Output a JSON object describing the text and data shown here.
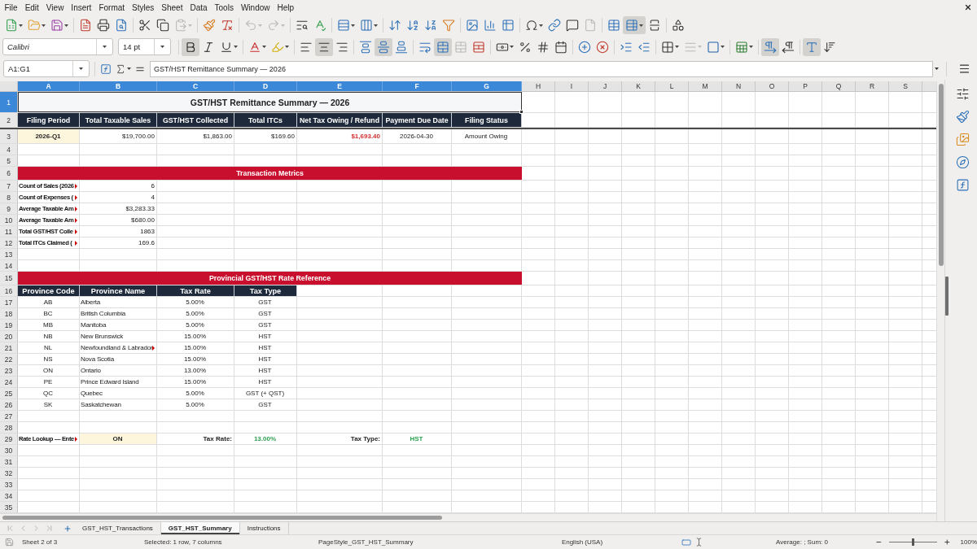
{
  "menu_bar": [
    "File",
    "Edit",
    "View",
    "Insert",
    "Format",
    "Styles",
    "Sheet",
    "Data",
    "Tools",
    "Window",
    "Help"
  ],
  "standard_toolbar": [
    [
      {
        "kind": "split",
        "active": false,
        "disabled": false
      },
      {
        "kind": "split",
        "active": false,
        "disabled": false
      },
      {
        "kind": "split",
        "active": false,
        "disabled": false
      }
    ],
    [
      {
        "kind": "button",
        "active": false,
        "disabled": false
      },
      {
        "kind": "button",
        "active": false,
        "disabled": false
      },
      {
        "kind": "button",
        "active": false,
        "disabled": false
      }
    ],
    [
      {
        "kind": "button",
        "active": false,
        "disabled": false
      },
      {
        "kind": "button",
        "active": false,
        "disabled": false
      },
      {
        "kind": "split",
        "active": false,
        "disabled": true
      }
    ],
    [
      {
        "kind": "button",
        "active": false,
        "disabled": false
      },
      {
        "kind": "button",
        "active": false,
        "disabled": false
      }
    ],
    [
      {
        "kind": "split",
        "active": false,
        "disabled": true
      },
      {
        "kind": "split",
        "active": false,
        "disabled": true
      }
    ],
    [
      {
        "kind": "button",
        "active": false,
        "disabled": false
      },
      {
        "kind": "button",
        "active": false,
        "disabled": false
      }
    ],
    [
      {
        "kind": "split",
        "active": false,
        "disabled": false
      },
      {
        "kind": "split",
        "active": false,
        "disabled": false
      }
    ],
    [
      {
        "kind": "button",
        "active": false,
        "disabled": false
      },
      {
        "kind": "button",
        "active": false,
        "disabled": false
      },
      {
        "kind": "button",
        "active": false,
        "disabled": false
      },
      {
        "kind": "button",
        "active": false,
        "disabled": false
      }
    ],
    [
      {
        "kind": "button",
        "active": false,
        "disabled": false
      },
      {
        "kind": "button",
        "active": false,
        "disabled": false
      },
      {
        "kind": "button",
        "active": false,
        "disabled": false
      }
    ],
    [
      {
        "kind": "split",
        "active": false,
        "disabled": false
      },
      {
        "kind": "button",
        "active": false,
        "disabled": false
      },
      {
        "kind": "button",
        "active": false,
        "disabled": false
      },
      {
        "kind": "button",
        "active": false,
        "disabled": true
      }
    ],
    [
      {
        "kind": "button",
        "active": false,
        "disabled": false
      },
      {
        "kind": "split",
        "active": true,
        "disabled": false
      },
      {
        "kind": "button",
        "active": false,
        "disabled": false
      }
    ],
    [
      {
        "kind": "button",
        "active": false,
        "disabled": false
      }
    ]
  ],
  "formatting_toolbar": {
    "font_name": "Calibri",
    "font_size": "14 pt",
    "groups": [
      [
        {
          "kind": "button",
          "active": true,
          "disabled": false
        },
        {
          "kind": "button",
          "active": false,
          "disabled": false
        },
        {
          "kind": "split",
          "active": false,
          "disabled": false
        }
      ],
      [
        {
          "kind": "split",
          "active": false,
          "disabled": false
        },
        {
          "kind": "split",
          "active": false,
          "disabled": false
        }
      ],
      [
        {
          "kind": "button",
          "active": false,
          "disabled": false
        },
        {
          "kind": "button",
          "active": true,
          "disabled": false
        },
        {
          "kind": "button",
          "active": false,
          "disabled": false
        }
      ],
      [
        {
          "kind": "button",
          "active": false,
          "disabled": false
        },
        {
          "kind": "button",
          "active": true,
          "disabled": false
        },
        {
          "kind": "button",
          "active": false,
          "disabled": false
        }
      ],
      [
        {
          "kind": "button",
          "active": false,
          "disabled": false
        },
        {
          "kind": "button",
          "active": true,
          "disabled": false
        },
        {
          "kind": "button",
          "active": false,
          "disabled": true
        },
        {
          "kind": "button",
          "active": false,
          "disabled": false
        }
      ],
      [
        {
          "kind": "split",
          "active": false,
          "disabled": false
        },
        {
          "kind": "button",
          "active": false,
          "disabled": false
        },
        {
          "kind": "button",
          "active": false,
          "disabled": false
        },
        {
          "kind": "button",
          "active": false,
          "disabled": false
        }
      ],
      [
        {
          "kind": "button",
          "active": false,
          "disabled": false
        },
        {
          "kind": "button",
          "active": false,
          "disabled": false
        }
      ],
      [
        {
          "kind": "button",
          "active": false,
          "disabled": false
        },
        {
          "kind": "button",
          "active": false,
          "disabled": false
        }
      ],
      [
        {
          "kind": "split",
          "active": false,
          "disabled": false
        },
        {
          "kind": "split",
          "active": false,
          "disabled": true
        },
        {
          "kind": "split",
          "active": false,
          "disabled": false
        }
      ],
      [
        {
          "kind": "split",
          "active": false,
          "disabled": false
        }
      ],
      [
        {
          "kind": "button",
          "active": true,
          "disabled": false
        },
        {
          "kind": "button",
          "active": false,
          "disabled": false
        }
      ],
      [
        {
          "kind": "button",
          "active": true,
          "disabled": false
        },
        {
          "kind": "button",
          "active": false,
          "disabled": false
        }
      ]
    ]
  },
  "formula_bar": {
    "name_box": "A1:G1",
    "content": "GST/HST Remittance Summary — 2026"
  },
  "sheet": {
    "columns": [
      {
        "label": "A",
        "selected": true
      },
      {
        "label": "B",
        "selected": true
      },
      {
        "label": "C",
        "selected": true
      },
      {
        "label": "D",
        "selected": true
      },
      {
        "label": "E",
        "selected": true
      },
      {
        "label": "F",
        "selected": true
      },
      {
        "label": "G",
        "selected": true
      },
      {
        "label": "H",
        "selected": false
      },
      {
        "label": "I",
        "selected": false
      },
      {
        "label": "J",
        "selected": false
      },
      {
        "label": "K",
        "selected": false
      },
      {
        "label": "L",
        "selected": false
      },
      {
        "label": "M",
        "selected": false
      },
      {
        "label": "N",
        "selected": false
      },
      {
        "label": "O",
        "selected": false
      },
      {
        "label": "P",
        "selected": false
      },
      {
        "label": "Q",
        "selected": false
      },
      {
        "label": "R",
        "selected": false
      },
      {
        "label": "S",
        "selected": false
      }
    ],
    "frozen_rows": [
      {
        "number": "1",
        "selected": true,
        "kind": "title",
        "cells": [
          {
            "text": "GST/HST Remittance Summary — 2026"
          }
        ]
      },
      {
        "number": "2",
        "selected": false,
        "kind": "header",
        "cells": [
          {
            "text": "Filing Period"
          },
          {
            "text": "Total Taxable Sales"
          },
          {
            "text": "GST/HST Collected"
          },
          {
            "text": "Total ITCs"
          },
          {
            "text": "Net Tax Owing / Refund"
          },
          {
            "text": "Payment Due Date"
          },
          {
            "text": "Filing Status"
          }
        ]
      }
    ],
    "rows": [
      {
        "number": "3",
        "selected": false,
        "kind": "data",
        "cells": [
          {
            "text": "2026-Q1",
            "kind": "input",
            "clipped": false
          },
          {
            "text": "$19,700.00",
            "kind": "number",
            "clipped": false
          },
          {
            "text": "$1,863.00",
            "kind": "number",
            "clipped": false
          },
          {
            "text": "$169.60",
            "kind": "number",
            "clipped": false
          },
          {
            "text": "$1,693.40",
            "kind": "alert",
            "clipped": false
          },
          {
            "text": "2026-04-30",
            "kind": "center",
            "clipped": false
          },
          {
            "text": "Amount Owing",
            "kind": "center",
            "clipped": false
          }
        ]
      },
      {
        "number": "4",
        "selected": false,
        "kind": "data"
      },
      {
        "number": "5",
        "selected": false,
        "kind": "data"
      },
      {
        "number": "6",
        "selected": false,
        "kind": "band",
        "cells": [
          {
            "text": "Transaction Metrics"
          }
        ]
      },
      {
        "number": "7",
        "selected": false,
        "kind": "data",
        "cells": [
          {
            "text": "Count of Sales (2026",
            "kind": "label",
            "clipped": true
          },
          {
            "text": "6",
            "kind": "number",
            "clipped": false
          }
        ]
      },
      {
        "number": "8",
        "selected": false,
        "kind": "data",
        "cells": [
          {
            "text": "Count of Expenses (",
            "kind": "label",
            "clipped": true
          },
          {
            "text": "4",
            "kind": "number",
            "clipped": false
          }
        ]
      },
      {
        "number": "9",
        "selected": false,
        "kind": "data",
        "cells": [
          {
            "text": "Average Taxable Am",
            "kind": "label",
            "clipped": true
          },
          {
            "text": "$3,283.33",
            "kind": "number",
            "clipped": false
          }
        ]
      },
      {
        "number": "10",
        "selected": false,
        "kind": "data",
        "cells": [
          {
            "text": "Average Taxable Am",
            "kind": "label",
            "clipped": true
          },
          {
            "text": "$680.00",
            "kind": "number",
            "clipped": false
          }
        ]
      },
      {
        "number": "11",
        "selected": false,
        "kind": "data",
        "cells": [
          {
            "text": "Total GST/HST Colle",
            "kind": "label",
            "clipped": true
          },
          {
            "text": "1863",
            "kind": "number",
            "clipped": false
          }
        ]
      },
      {
        "number": "12",
        "selected": false,
        "kind": "data",
        "cells": [
          {
            "text": "Total ITCs Claimed (",
            "kind": "label",
            "clipped": true
          },
          {
            "text": "169.6",
            "kind": "number",
            "clipped": false
          }
        ]
      },
      {
        "number": "13",
        "selected": false,
        "kind": "data"
      },
      {
        "number": "14",
        "selected": false,
        "kind": "data"
      },
      {
        "number": "15",
        "selected": false,
        "kind": "band",
        "cells": [
          {
            "text": "Provincial GST/HST Rate Reference"
          }
        ]
      },
      {
        "number": "16",
        "selected": false,
        "kind": "header",
        "cells": [
          {
            "text": "Province Code"
          },
          {
            "text": "Province Name"
          },
          {
            "text": "Tax Rate"
          },
          {
            "text": "Tax Type"
          }
        ]
      },
      {
        "number": "17",
        "selected": false,
        "kind": "data",
        "cells": [
          {
            "text": "AB",
            "kind": "center",
            "clipped": false
          },
          {
            "text": "Alberta",
            "kind": "text",
            "clipped": false
          },
          {
            "text": "5.00%",
            "kind": "center",
            "clipped": false
          },
          {
            "text": "GST",
            "kind": "center",
            "clipped": false
          }
        ]
      },
      {
        "number": "18",
        "selected": false,
        "kind": "data",
        "cells": [
          {
            "text": "BC",
            "kind": "center",
            "clipped": false
          },
          {
            "text": "British Columbia",
            "kind": "text",
            "clipped": false
          },
          {
            "text": "5.00%",
            "kind": "center",
            "clipped": false
          },
          {
            "text": "GST",
            "kind": "center",
            "clipped": false
          }
        ]
      },
      {
        "number": "19",
        "selected": false,
        "kind": "data",
        "cells": [
          {
            "text": "MB",
            "kind": "center",
            "clipped": false
          },
          {
            "text": "Manitoba",
            "kind": "text",
            "clipped": false
          },
          {
            "text": "5.00%",
            "kind": "center",
            "clipped": false
          },
          {
            "text": "GST",
            "kind": "center",
            "clipped": false
          }
        ]
      },
      {
        "number": "20",
        "selected": false,
        "kind": "data",
        "cells": [
          {
            "text": "NB",
            "kind": "center",
            "clipped": false
          },
          {
            "text": "New Brunswick",
            "kind": "text",
            "clipped": false
          },
          {
            "text": "15.00%",
            "kind": "center",
            "clipped": false
          },
          {
            "text": "HST",
            "kind": "center",
            "clipped": false
          }
        ]
      },
      {
        "number": "21",
        "selected": false,
        "kind": "data",
        "cells": [
          {
            "text": "NL",
            "kind": "center",
            "clipped": false
          },
          {
            "text": "Newfoundland & Labrador",
            "kind": "text",
            "clipped": true
          },
          {
            "text": "15.00%",
            "kind": "center",
            "clipped": false
          },
          {
            "text": "HST",
            "kind": "center",
            "clipped": false
          }
        ]
      },
      {
        "number": "22",
        "selected": false,
        "kind": "data",
        "cells": [
          {
            "text": "NS",
            "kind": "center",
            "clipped": false
          },
          {
            "text": "Nova Scotia",
            "kind": "text",
            "clipped": false
          },
          {
            "text": "15.00%",
            "kind": "center",
            "clipped": false
          },
          {
            "text": "HST",
            "kind": "center",
            "clipped": false
          }
        ]
      },
      {
        "number": "23",
        "selected": false,
        "kind": "data",
        "cells": [
          {
            "text": "ON",
            "kind": "center",
            "clipped": false
          },
          {
            "text": "Ontario",
            "kind": "text",
            "clipped": false
          },
          {
            "text": "13.00%",
            "kind": "center",
            "clipped": false
          },
          {
            "text": "HST",
            "kind": "center",
            "clipped": false
          }
        ]
      },
      {
        "number": "24",
        "selected": false,
        "kind": "data",
        "cells": [
          {
            "text": "PE",
            "kind": "center",
            "clipped": false
          },
          {
            "text": "Prince Edward Island",
            "kind": "text",
            "clipped": false
          },
          {
            "text": "15.00%",
            "kind": "center",
            "clipped": false
          },
          {
            "text": "HST",
            "kind": "center",
            "clipped": false
          }
        ]
      },
      {
        "number": "25",
        "selected": false,
        "kind": "data",
        "cells": [
          {
            "text": "QC",
            "kind": "center",
            "clipped": false
          },
          {
            "text": "Quebec",
            "kind": "text",
            "clipped": false
          },
          {
            "text": "5.00%",
            "kind": "center",
            "clipped": false
          },
          {
            "text": "GST (+ QST)",
            "kind": "center",
            "clipped": false
          }
        ]
      },
      {
        "number": "26",
        "selected": false,
        "kind": "data",
        "cells": [
          {
            "text": "SK",
            "kind": "center",
            "clipped": false
          },
          {
            "text": "Saskatchewan",
            "kind": "text",
            "clipped": false
          },
          {
            "text": "5.00%",
            "kind": "center",
            "clipped": false
          },
          {
            "text": "GST",
            "kind": "center",
            "clipped": false
          }
        ]
      },
      {
        "number": "27",
        "selected": false,
        "kind": "data"
      },
      {
        "number": "28",
        "selected": false,
        "kind": "data"
      },
      {
        "number": "29",
        "selected": false,
        "kind": "data",
        "cells": [
          {
            "text": "Rate Lookup — Ente",
            "kind": "label",
            "clipped": true
          },
          {
            "text": "ON",
            "kind": "input",
            "clipped": false
          },
          {
            "text": "Tax Rate:",
            "kind": "caption",
            "clipped": false
          },
          {
            "text": "13.00%",
            "kind": "result",
            "clipped": false
          },
          {
            "text": "Tax Type:",
            "kind": "caption",
            "clipped": false
          },
          {
            "text": "HST",
            "kind": "result",
            "clipped": false
          }
        ]
      },
      {
        "number": "30",
        "selected": false,
        "kind": "data"
      },
      {
        "number": "31",
        "selected": false,
        "kind": "data"
      },
      {
        "number": "32",
        "selected": false,
        "kind": "data"
      },
      {
        "number": "33",
        "selected": false,
        "kind": "data"
      },
      {
        "number": "34",
        "selected": false,
        "kind": "data"
      },
      {
        "number": "35",
        "selected": false,
        "kind": "data"
      }
    ]
  },
  "sheet_tabs": [
    {
      "label": "GST_HST_Transactions",
      "selected": false
    },
    {
      "label": "GST_HST_Summary",
      "selected": true
    },
    {
      "label": "Instructions",
      "selected": false
    }
  ],
  "status_bar": {
    "sheet": "Sheet 2 of 3",
    "selection": "Selected: 1 row, 7 columns",
    "page_style": "PageStyle_GST_HST_Summary",
    "language": "English (USA)",
    "summary": "Average: ; Sum: 0",
    "zoom": {
      "level": 0.5,
      "reading": "100%"
    }
  }
}
